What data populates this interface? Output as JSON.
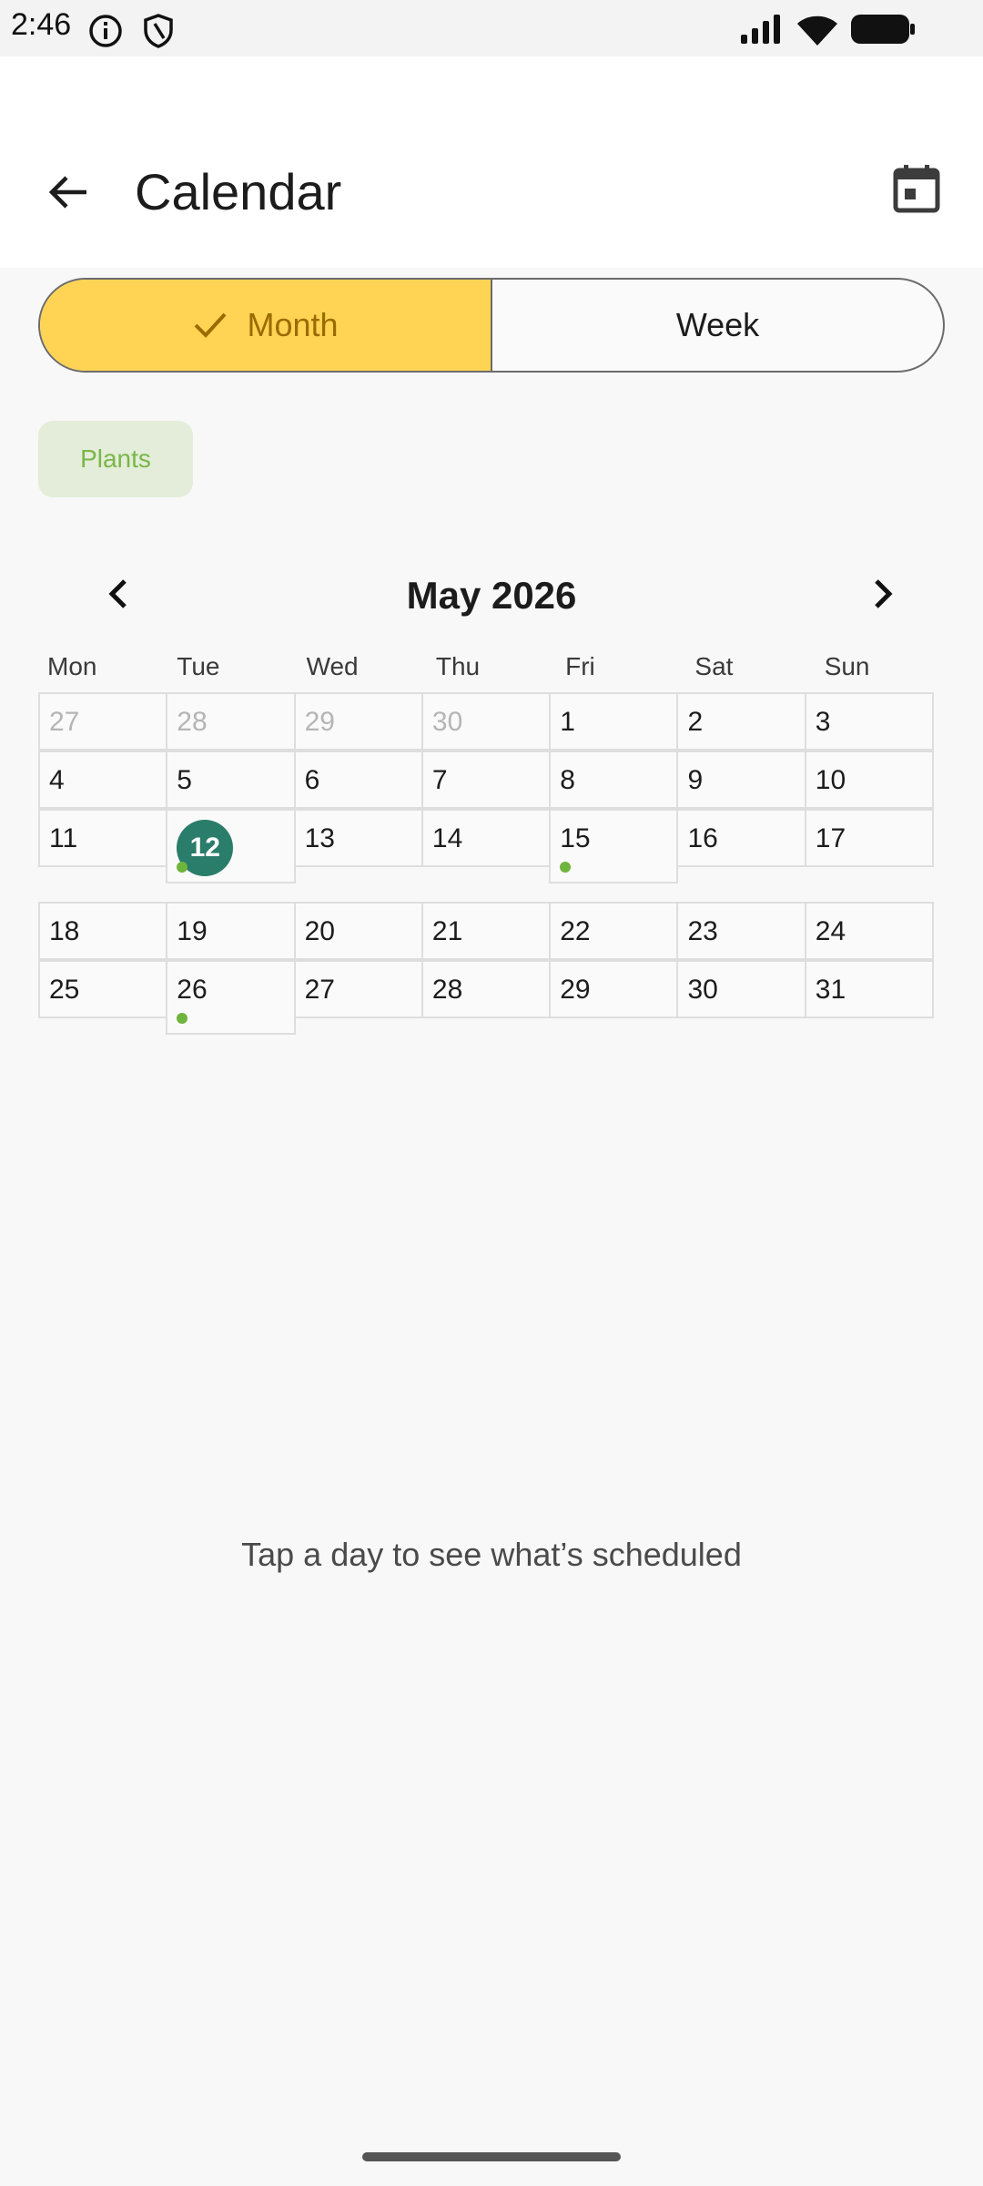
{
  "status_bar": {
    "time": "2:46"
  },
  "app_bar": {
    "title": "Calendar"
  },
  "view_toggle": {
    "month": "Month",
    "week": "Week",
    "selected": "Month"
  },
  "filters": {
    "chip": "Plants"
  },
  "calendar": {
    "month_label": "May 2026",
    "weekdays": [
      "Mon",
      "Tue",
      "Wed",
      "Thu",
      "Fri",
      "Sat",
      "Sun"
    ],
    "weeks": [
      [
        {
          "d": "27",
          "muted": true
        },
        {
          "d": "28",
          "muted": true
        },
        {
          "d": "29",
          "muted": true
        },
        {
          "d": "30",
          "muted": true
        },
        {
          "d": "1"
        },
        {
          "d": "2"
        },
        {
          "d": "3"
        }
      ],
      [
        {
          "d": "4"
        },
        {
          "d": "5"
        },
        {
          "d": "6"
        },
        {
          "d": "7"
        },
        {
          "d": "8"
        },
        {
          "d": "9"
        },
        {
          "d": "10"
        }
      ],
      [
        {
          "d": "11"
        },
        {
          "d": "12",
          "today": true,
          "dot": true
        },
        {
          "d": "13"
        },
        {
          "d": "14"
        },
        {
          "d": "15",
          "dot": true
        },
        {
          "d": "16"
        },
        {
          "d": "17"
        }
      ],
      [
        {
          "d": "18"
        },
        {
          "d": "19"
        },
        {
          "d": "20"
        },
        {
          "d": "21"
        },
        {
          "d": "22"
        },
        {
          "d": "23"
        },
        {
          "d": "24"
        }
      ],
      [
        {
          "d": "25"
        },
        {
          "d": "26",
          "dot": true
        },
        {
          "d": "27"
        },
        {
          "d": "28"
        },
        {
          "d": "29"
        },
        {
          "d": "30"
        },
        {
          "d": "31"
        }
      ]
    ]
  },
  "empty_state": {
    "message": "Tap a day to see what’s scheduled"
  },
  "colors": {
    "accent": "#ffd454",
    "today": "#2a7c6b",
    "event_dot": "#6fb43c",
    "chip_bg": "#e3edd9"
  }
}
